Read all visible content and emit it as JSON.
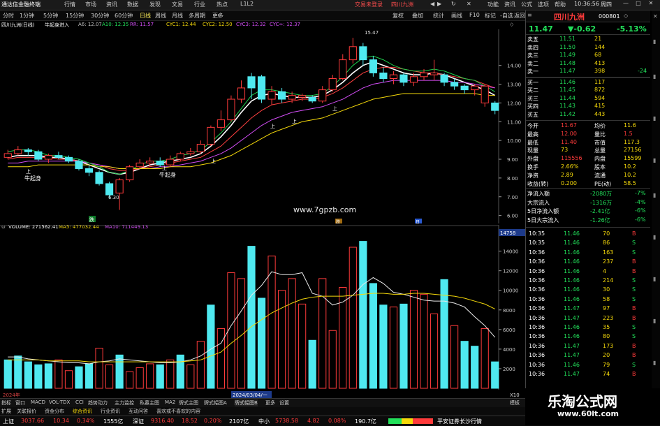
{
  "app_title": "通达信金融终端",
  "menu": [
    "行情",
    "市场",
    "资讯",
    "数据",
    "发现",
    "文易",
    "行业",
    "热点",
    "L1L2"
  ],
  "login_text": "交易未登录",
  "menu_stock": "四川九洲",
  "menu_right": [
    "功能",
    "资讯",
    "公式",
    "选项",
    "帮助"
  ],
  "clock": "10:36:56",
  "clock_sub": "周四",
  "periods": [
    "分时",
    "1分钟",
    "5分钟",
    "15分钟",
    "30分钟",
    "60分钟",
    "日线",
    "周线",
    "月线",
    "多周期",
    "更多"
  ],
  "toolbar_right": [
    "复权",
    "叠加",
    "统计",
    "画线",
    "F10",
    "标记",
    "-自选",
    "返回"
  ],
  "info": {
    "stock": "四川九洲(日线)",
    "indicator": "牛起身进入",
    "a6": "A6: 12.07",
    "a10": "A10: 12.35",
    "rr": "RR: 11.57",
    "cyc1": "CYC1: 12.44",
    "cyc2": "CYC2: 12.50",
    "cyc3": "CYC3: 12.32",
    "cycinf": "CYC∞: 12.37"
  },
  "price_axis": [
    "14.00",
    "13.00",
    "12.00",
    "11.00",
    "10.00",
    "9.00",
    "8.00",
    "7.00",
    "6.00"
  ],
  "annotations": {
    "high": "15.47",
    "low": "6.30",
    "qs1": "牛起身",
    "qs2": "牛起身",
    "up": "上",
    "watermark": "www.7gpzb.com",
    "mark_left": "跌",
    "mark_mid": "跌",
    "mark_right": "日"
  },
  "volume": {
    "label": "VOLUME: 271562.41",
    "ma5": "MA5: 477032.44",
    "ma10": "MA10: 711449.13",
    "axis": [
      "14000",
      "12000",
      "10000",
      "8000",
      "6000",
      "4000",
      "2000"
    ],
    "axis_top": "14758",
    "unit_label": "X10",
    "bars": [
      {
        "v": 2900,
        "c": "cyan"
      },
      {
        "v": 3300,
        "c": "cyan"
      },
      {
        "v": 2700,
        "c": "cyan"
      },
      {
        "v": 2400,
        "c": "cyan"
      },
      {
        "v": 2500,
        "c": "cyan"
      },
      {
        "v": 2900,
        "c": "red"
      },
      {
        "v": 1800,
        "c": "red"
      },
      {
        "v": 2200,
        "c": "cyan"
      },
      {
        "v": 2500,
        "c": "cyan"
      },
      {
        "v": 4100,
        "c": "red"
      },
      {
        "v": 2400,
        "c": "red"
      },
      {
        "v": 3400,
        "c": "cyan"
      },
      {
        "v": 1700,
        "c": "red"
      },
      {
        "v": 2100,
        "c": "red"
      },
      {
        "v": 2500,
        "c": "red"
      },
      {
        "v": 2400,
        "c": "cyan"
      },
      {
        "v": 2900,
        "c": "red"
      },
      {
        "v": 3400,
        "c": "cyan"
      },
      {
        "v": 2400,
        "c": "red"
      },
      {
        "v": 4800,
        "c": "red"
      },
      {
        "v": 8500,
        "c": "cyan"
      },
      {
        "v": 6100,
        "c": "red"
      },
      {
        "v": 11800,
        "c": "red"
      },
      {
        "v": 11200,
        "c": "red"
      },
      {
        "v": 14500,
        "c": "cyan"
      },
      {
        "v": 9200,
        "c": "cyan"
      },
      {
        "v": 13500,
        "c": "red"
      },
      {
        "v": 10000,
        "c": "red"
      },
      {
        "v": 11200,
        "c": "red"
      },
      {
        "v": 8600,
        "c": "red"
      },
      {
        "v": 4900,
        "c": "cyan"
      },
      {
        "v": 11200,
        "c": "red"
      },
      {
        "v": 5900,
        "c": "red"
      },
      {
        "v": 10300,
        "c": "red"
      },
      {
        "v": 14400,
        "c": "red"
      },
      {
        "v": 15000,
        "c": "cyan"
      },
      {
        "v": 10700,
        "c": "cyan"
      },
      {
        "v": 8500,
        "c": "cyan"
      },
      {
        "v": 8300,
        "c": "red"
      },
      {
        "v": 8600,
        "c": "cyan"
      },
      {
        "v": 10000,
        "c": "red"
      },
      {
        "v": 9600,
        "c": "red"
      },
      {
        "v": 7600,
        "c": "red"
      },
      {
        "v": 11100,
        "c": "cyan"
      },
      {
        "v": 6400,
        "c": "red"
      },
      {
        "v": 4800,
        "c": "cyan"
      },
      {
        "v": 4300,
        "c": "cyan"
      },
      {
        "v": 6100,
        "c": "red"
      },
      {
        "v": 2700,
        "c": "cyan"
      }
    ],
    "ma": [
      3200,
      3200,
      3000,
      2900,
      2800,
      2700,
      2600,
      2600,
      2500,
      2700,
      2800,
      3000,
      2900,
      2800,
      2700,
      2600,
      2600,
      2700,
      2900,
      3300,
      4000,
      4600,
      6400,
      7900,
      9500,
      10500,
      11900,
      11600,
      11600,
      11800,
      9700,
      9400,
      8500,
      8800,
      9500,
      10600,
      11300,
      10700,
      9800,
      9600,
      9300,
      9000,
      8900,
      8900,
      8700,
      8300,
      7300,
      6400,
      5200
    ],
    "ma_long": [
      2900,
      2900,
      2900,
      2900,
      2800,
      2800,
      2800,
      2800,
      2700,
      2700,
      2700,
      2700,
      2700,
      2700,
      2700,
      2700,
      2700,
      2700,
      2800,
      2900,
      3300,
      3700,
      4600,
      5400,
      6300,
      7000,
      7700,
      8200,
      8700,
      9100,
      9300,
      9400,
      9400,
      9400,
      9500,
      9600,
      9700,
      9700,
      9600,
      9600,
      9700,
      9700,
      9600,
      9500,
      9400,
      9200,
      8900,
      8600,
      8100
    ]
  },
  "candles": [
    {
      "o": 9.1,
      "c": 9.3,
      "h": 9.5,
      "l": 9.0,
      "col": "red"
    },
    {
      "o": 9.3,
      "c": 9.5,
      "h": 9.7,
      "l": 9.2,
      "col": "red"
    },
    {
      "o": 9.5,
      "c": 9.4,
      "h": 9.6,
      "l": 9.2,
      "col": "cyan"
    },
    {
      "o": 9.4,
      "c": 9.0,
      "h": 9.5,
      "l": 8.9,
      "col": "cyan"
    },
    {
      "o": 9.0,
      "c": 9.2,
      "h": 9.3,
      "l": 8.8,
      "col": "red"
    },
    {
      "o": 9.2,
      "c": 9.1,
      "h": 9.4,
      "l": 9.0,
      "col": "cyan"
    },
    {
      "o": 9.1,
      "c": 8.9,
      "h": 9.2,
      "l": 8.8,
      "col": "cyan"
    },
    {
      "o": 8.9,
      "c": 8.5,
      "h": 9.0,
      "l": 8.4,
      "col": "cyan"
    },
    {
      "o": 8.5,
      "c": 8.3,
      "h": 8.7,
      "l": 8.1,
      "col": "cyan"
    },
    {
      "o": 8.3,
      "c": 7.7,
      "h": 8.4,
      "l": 7.6,
      "col": "cyan"
    },
    {
      "o": 7.7,
      "c": 7.1,
      "h": 7.8,
      "l": 6.9,
      "col": "cyan"
    },
    {
      "o": 7.2,
      "c": 7.9,
      "h": 8.0,
      "l": 6.3,
      "col": "red"
    },
    {
      "o": 7.9,
      "c": 8.6,
      "h": 8.7,
      "l": 7.8,
      "col": "red"
    },
    {
      "o": 8.6,
      "c": 8.8,
      "h": 9.0,
      "l": 8.5,
      "col": "red"
    },
    {
      "o": 8.8,
      "c": 8.9,
      "h": 9.1,
      "l": 8.6,
      "col": "red"
    },
    {
      "o": 8.9,
      "c": 8.7,
      "h": 9.1,
      "l": 8.6,
      "col": "cyan"
    },
    {
      "o": 8.7,
      "c": 9.0,
      "h": 9.2,
      "l": 8.6,
      "col": "red"
    },
    {
      "o": 9.0,
      "c": 9.3,
      "h": 9.4,
      "l": 8.9,
      "col": "red"
    },
    {
      "o": 9.3,
      "c": 9.4,
      "h": 9.6,
      "l": 9.2,
      "col": "red"
    },
    {
      "o": 9.4,
      "c": 9.8,
      "h": 10.0,
      "l": 9.3,
      "col": "red"
    },
    {
      "o": 9.8,
      "c": 10.7,
      "h": 10.8,
      "l": 9.7,
      "col": "red"
    },
    {
      "o": 10.7,
      "c": 11.1,
      "h": 11.6,
      "l": 10.5,
      "col": "red"
    },
    {
      "o": 11.1,
      "c": 12.2,
      "h": 12.4,
      "l": 11.0,
      "col": "red"
    },
    {
      "o": 12.2,
      "c": 12.8,
      "h": 13.2,
      "l": 12.0,
      "col": "red"
    },
    {
      "o": 12.8,
      "c": 13.4,
      "h": 13.6,
      "l": 12.2,
      "col": "cyan"
    },
    {
      "o": 13.4,
      "c": 12.2,
      "h": 13.5,
      "l": 12.0,
      "col": "cyan"
    },
    {
      "o": 12.2,
      "c": 12.6,
      "h": 12.9,
      "l": 11.9,
      "col": "red"
    },
    {
      "o": 12.6,
      "c": 12.2,
      "h": 12.8,
      "l": 12.0,
      "col": "cyan"
    },
    {
      "o": 12.2,
      "c": 12.4,
      "h": 12.6,
      "l": 12.0,
      "col": "red"
    },
    {
      "o": 12.4,
      "c": 12.3,
      "h": 12.5,
      "l": 12.1,
      "col": "red"
    },
    {
      "o": 12.3,
      "c": 12.1,
      "h": 12.4,
      "l": 12.0,
      "col": "cyan"
    },
    {
      "o": 12.1,
      "c": 12.7,
      "h": 12.9,
      "l": 12.0,
      "col": "red"
    },
    {
      "o": 12.7,
      "c": 13.3,
      "h": 13.5,
      "l": 12.6,
      "col": "red"
    },
    {
      "o": 13.3,
      "c": 14.3,
      "h": 14.6,
      "l": 13.2,
      "col": "red"
    },
    {
      "o": 14.3,
      "c": 15.0,
      "h": 15.47,
      "l": 14.1,
      "col": "red"
    },
    {
      "o": 15.0,
      "c": 14.3,
      "h": 15.2,
      "l": 14.0,
      "col": "cyan"
    },
    {
      "o": 14.3,
      "c": 13.6,
      "h": 14.5,
      "l": 13.4,
      "col": "cyan"
    },
    {
      "o": 13.6,
      "c": 13.3,
      "h": 13.9,
      "l": 13.1,
      "col": "cyan"
    },
    {
      "o": 13.3,
      "c": 13.5,
      "h": 13.7,
      "l": 13.0,
      "col": "red"
    },
    {
      "o": 13.5,
      "c": 13.1,
      "h": 13.6,
      "l": 12.9,
      "col": "cyan"
    },
    {
      "o": 13.1,
      "c": 13.4,
      "h": 13.6,
      "l": 12.9,
      "col": "red"
    },
    {
      "o": 13.4,
      "c": 13.6,
      "h": 13.8,
      "l": 13.2,
      "col": "red"
    },
    {
      "o": 13.6,
      "c": 13.5,
      "h": 14.3,
      "l": 13.2,
      "col": "red"
    },
    {
      "o": 13.5,
      "c": 13.1,
      "h": 13.6,
      "l": 12.9,
      "col": "cyan"
    },
    {
      "o": 13.1,
      "c": 12.9,
      "h": 13.3,
      "l": 12.7,
      "col": "cyan"
    },
    {
      "o": 12.9,
      "c": 12.7,
      "h": 13.0,
      "l": 12.5,
      "col": "cyan"
    },
    {
      "o": 12.7,
      "c": 12.9,
      "h": 13.0,
      "l": 12.4,
      "col": "red"
    },
    {
      "o": 12.9,
      "c": 12.0,
      "h": 13.0,
      "l": 11.8,
      "col": "red"
    },
    {
      "o": 12.0,
      "c": 11.6,
      "h": 12.1,
      "l": 11.4,
      "col": "cyan"
    }
  ],
  "ma_lines": {
    "white": [
      9.1,
      9.2,
      9.2,
      9.2,
      9.1,
      9.1,
      9.0,
      8.9,
      8.7,
      8.5,
      8.3,
      8.2,
      8.3,
      8.5,
      8.7,
      8.8,
      8.9,
      9.0,
      9.1,
      9.3,
      9.7,
      10.2,
      10.8,
      11.5,
      12.1,
      12.4,
      12.5,
      12.4,
      12.3,
      12.3,
      12.3,
      12.4,
      12.7,
      13.1,
      13.6,
      14.0,
      14.2,
      14.0,
      13.8,
      13.6,
      13.5,
      13.5,
      13.6,
      13.5,
      13.3,
      13.1,
      12.9,
      12.7,
      12.4
    ],
    "red": [
      9.0,
      9.1,
      9.1,
      9.1,
      9.1,
      9.0,
      9.0,
      8.9,
      8.8,
      8.7,
      8.5,
      8.4,
      8.4,
      8.5,
      8.6,
      8.7,
      8.8,
      8.9,
      9.0,
      9.1,
      9.4,
      9.7,
      10.2,
      10.7,
      11.2,
      11.6,
      11.9,
      12.0,
      12.1,
      12.2,
      12.2,
      12.3,
      12.5,
      12.8,
      13.2,
      13.6,
      13.8,
      13.9,
      13.9,
      13.8,
      13.7,
      13.6,
      13.6,
      13.5,
      13.4,
      13.3,
      13.2,
      13.0,
      12.8
    ],
    "purple": [
      8.8,
      8.8,
      8.9,
      8.9,
      8.9,
      8.9,
      8.9,
      8.9,
      8.8,
      8.7,
      8.6,
      8.5,
      8.5,
      8.5,
      8.5,
      8.6,
      8.6,
      8.7,
      8.8,
      8.9,
      9.1,
      9.3,
      9.6,
      10.0,
      10.4,
      10.8,
      11.1,
      11.3,
      11.5,
      11.6,
      11.7,
      11.8,
      12.0,
      12.2,
      12.5,
      12.8,
      13.0,
      13.1,
      13.2,
      13.2,
      13.2,
      13.2,
      13.2,
      13.2,
      13.1,
      13.1,
      13.0,
      12.9,
      12.8
    ],
    "yellow": [
      8.6,
      8.6,
      8.6,
      8.7,
      8.7,
      8.7,
      8.7,
      8.7,
      8.7,
      8.6,
      8.6,
      8.5,
      8.5,
      8.5,
      8.5,
      8.5,
      8.6,
      8.6,
      8.6,
      8.7,
      8.8,
      9.0,
      9.2,
      9.5,
      9.8,
      10.1,
      10.4,
      10.6,
      10.8,
      11.0,
      11.1,
      11.2,
      11.4,
      11.6,
      11.8,
      12.0,
      12.2,
      12.3,
      12.4,
      12.5,
      12.5,
      12.5,
      12.5,
      12.5,
      12.5,
      12.5,
      12.5,
      12.4,
      12.4
    ],
    "green": [
      9.4,
      9.5,
      9.5,
      9.4,
      9.2,
      9.2,
      9.1,
      9.0,
      8.8,
      8.6,
      8.3,
      8.2,
      8.4,
      8.7,
      8.9,
      8.9,
      9.0,
      9.2,
      9.3,
      9.5,
      9.9,
      10.4,
      11.0,
      11.7,
      12.4,
      12.7,
      12.7,
      12.6,
      12.5,
      12.4,
      12.4,
      12.5,
      12.9,
      13.4,
      14.0,
      14.4,
      14.5,
      14.3,
      14.0,
      13.8,
      13.7,
      13.7,
      13.8,
      13.7,
      13.5,
      13.3,
      13.2,
      12.9,
      12.6
    ]
  },
  "right_panel": {
    "name": "四川九洲",
    "code": "000801",
    "price": "11.47",
    "change": "▼-0.62",
    "pct": "-5.13%",
    "asks": [
      {
        "label": "卖五",
        "price": "11.51",
        "vol": "21",
        "chg": ""
      },
      {
        "label": "卖四",
        "price": "11.50",
        "vol": "144",
        "chg": ""
      },
      {
        "label": "卖三",
        "price": "11.49",
        "vol": "68",
        "chg": ""
      },
      {
        "label": "卖二",
        "price": "11.48",
        "vol": "413",
        "chg": ""
      },
      {
        "label": "卖一",
        "price": "11.47",
        "vol": "398",
        "chg": "-24"
      }
    ],
    "bids": [
      {
        "label": "买一",
        "price": "11.46",
        "vol": "117",
        "chg": ""
      },
      {
        "label": "买二",
        "price": "11.45",
        "vol": "872",
        "chg": ""
      },
      {
        "label": "买三",
        "price": "11.44",
        "vol": "594",
        "chg": ""
      },
      {
        "label": "买四",
        "price": "11.43",
        "vol": "415",
        "chg": ""
      },
      {
        "label": "买五",
        "price": "11.42",
        "vol": "443",
        "chg": ""
      }
    ],
    "stats": [
      {
        "l1": "今开",
        "v1": "11.67",
        "l2": "均价",
        "v2": "11.6"
      },
      {
        "l1": "最高",
        "v1": "12.00",
        "l2": "量比",
        "v2": "1.5"
      },
      {
        "l1": "最低",
        "v1": "11.40",
        "l2": "市值",
        "v2": "117.3"
      },
      {
        "l1": "现量",
        "v1": "73",
        "l2": "总量",
        "v2": "27156"
      },
      {
        "l1": "外盘",
        "v1": "115556",
        "l2": "内盘",
        "v2": "15599"
      },
      {
        "l1": "换手",
        "v1": "2.66%",
        "l2": "股本",
        "v2": "10.2"
      },
      {
        "l1": "净资",
        "v1": "2.89",
        "l2": "流通",
        "v2": "10.2"
      },
      {
        "l1": "收益(转)",
        "v1": "0.200",
        "l2": "PE(动)",
        "v2": "58.5"
      }
    ],
    "flows": [
      {
        "label": "净流入额",
        "value": "-2080万",
        "pct": "-7%"
      },
      {
        "label": "大宗流入",
        "value": "-1316万",
        "pct": "-4%"
      },
      {
        "label": "5日净流入额",
        "value": "-2.41亿",
        "pct": "-6%"
      },
      {
        "label": "5日大宗流入",
        "value": "-1.26亿",
        "pct": "-6%"
      }
    ],
    "ticks": [
      {
        "t": "10:35",
        "p": "11.46",
        "v": "70",
        "d": "B"
      },
      {
        "t": "10:35",
        "p": "11.46",
        "v": "86",
        "d": "S"
      },
      {
        "t": "10:36",
        "p": "11.46",
        "v": "163",
        "d": "S"
      },
      {
        "t": "10:36",
        "p": "11.46",
        "v": "237",
        "d": "B"
      },
      {
        "t": "10:36",
        "p": "11.46",
        "v": "4",
        "d": "B"
      },
      {
        "t": "10:36",
        "p": "11.46",
        "v": "214",
        "d": "S"
      },
      {
        "t": "10:36",
        "p": "11.46",
        "v": "30",
        "d": "S"
      },
      {
        "t": "10:36",
        "p": "11.46",
        "v": "58",
        "d": "S"
      },
      {
        "t": "10:36",
        "p": "11.47",
        "v": "97",
        "d": "B"
      },
      {
        "t": "10:36",
        "p": "11.47",
        "v": "223",
        "d": "B"
      },
      {
        "t": "10:36",
        "p": "11.46",
        "v": "35",
        "d": "S"
      },
      {
        "t": "10:36",
        "p": "11.46",
        "v": "80",
        "d": "S"
      },
      {
        "t": "10:36",
        "p": "11.47",
        "v": "173",
        "d": "B"
      },
      {
        "t": "10:36",
        "p": "11.47",
        "v": "20",
        "d": "B"
      },
      {
        "t": "10:36",
        "p": "11.46",
        "v": "79",
        "d": "S"
      },
      {
        "t": "10:36",
        "p": "11.47",
        "v": "74",
        "d": "B"
      }
    ]
  },
  "bottom_tabs": [
    "指标",
    "窗口",
    "MACD",
    "VOL-TDX",
    "CCI",
    "趋势动力",
    "主力监控",
    "私募主图",
    "MA2",
    "牌式主图",
    "牌式幅图A",
    "牌式幅图B",
    "更多",
    "设置"
  ],
  "bottom_tabs2": [
    "扩展",
    "关联报价",
    "资金分布",
    "综合资讯",
    "行业资讯",
    "互动问答",
    "喜欢或不喜欢的内容"
  ],
  "tab_right": "模板",
  "date_box": "2024/03/04/一",
  "year_label": "2024年",
  "status": {
    "sh_name": "上证",
    "sh_val": "3037.66",
    "sh_chg": "10.34",
    "sh_pct": "0.34%",
    "sh_amt": "1555亿",
    "sz_name": "深证",
    "sz_val": "9316.40",
    "sz_chg": "18.52",
    "sz_pct": "0.20%",
    "sz_amt": "2107亿",
    "zx_name": "中小",
    "zx_val": "5738.58",
    "zx_chg": "4.82",
    "zx_pct": "0.08%",
    "zx_amt": "190.7亿",
    "broker": "平安证券长沙行情"
  },
  "logo": {
    "title": "乐淘公式网",
    "url": "www.60lt.com"
  },
  "colors": {
    "up": "#ff3b3b",
    "down": "#22e05a",
    "candle_down": "#4fe9f0",
    "accent": "#f5d90a"
  }
}
